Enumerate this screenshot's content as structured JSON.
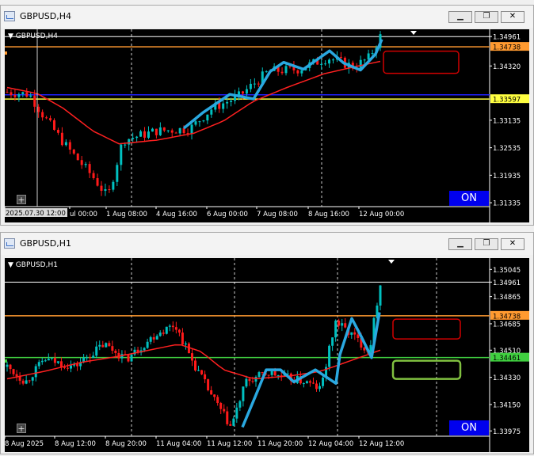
{
  "window1": {
    "title": "GBPUSD,H4",
    "symbol_label": "GBPUSD,H4",
    "on_label": "ON",
    "price_labels": [
      "1.34961",
      "1.34738",
      "1.34320",
      "1.33597",
      "1.33135",
      "1.32535",
      "1.31935",
      "1.31335"
    ],
    "time_labels": [
      "2025.07.30 12:00",
      "ul 00:00",
      "1 Aug 08:00",
      "4 Aug 16:00",
      "6 Aug 00:00",
      "7 Aug 08:00",
      "8 Aug 16:00",
      "12 Aug 00:00"
    ],
    "ymin": 1.3125,
    "ymax": 1.3512
  },
  "window2": {
    "title": "GBPUSD,H1",
    "symbol_label": "GBPUSD,H1",
    "on_label": "ON",
    "price_labels": [
      "1.35045",
      "1.34961",
      "1.34865",
      "1.34738",
      "1.34685",
      "1.34510",
      "1.34461",
      "1.34330",
      "1.34150",
      "1.33975"
    ],
    "time_labels": [
      "8 Aug 2025",
      "8 Aug 12:00",
      "8 Aug 20:00",
      "11 Aug 04:00",
      "11 Aug 12:00",
      "11 Aug 20:00",
      "12 Aug 04:00",
      "12 Aug 12:00"
    ],
    "ymin": 1.3394,
    "ymax": 1.3512
  },
  "window_buttons": {
    "minimize": "▁",
    "restore": "❐",
    "close": "✕"
  },
  "colors": {
    "bull": "#00c0c0",
    "bear": "#ff1a1a",
    "ma": "#ff2020",
    "trend": "#2aa8e0",
    "orange": "#ff9a30",
    "yellow": "#ffff40",
    "blue": "#2020ff",
    "green": "#40d040",
    "box_red": "#d00000",
    "box_green": "#80c040"
  }
}
